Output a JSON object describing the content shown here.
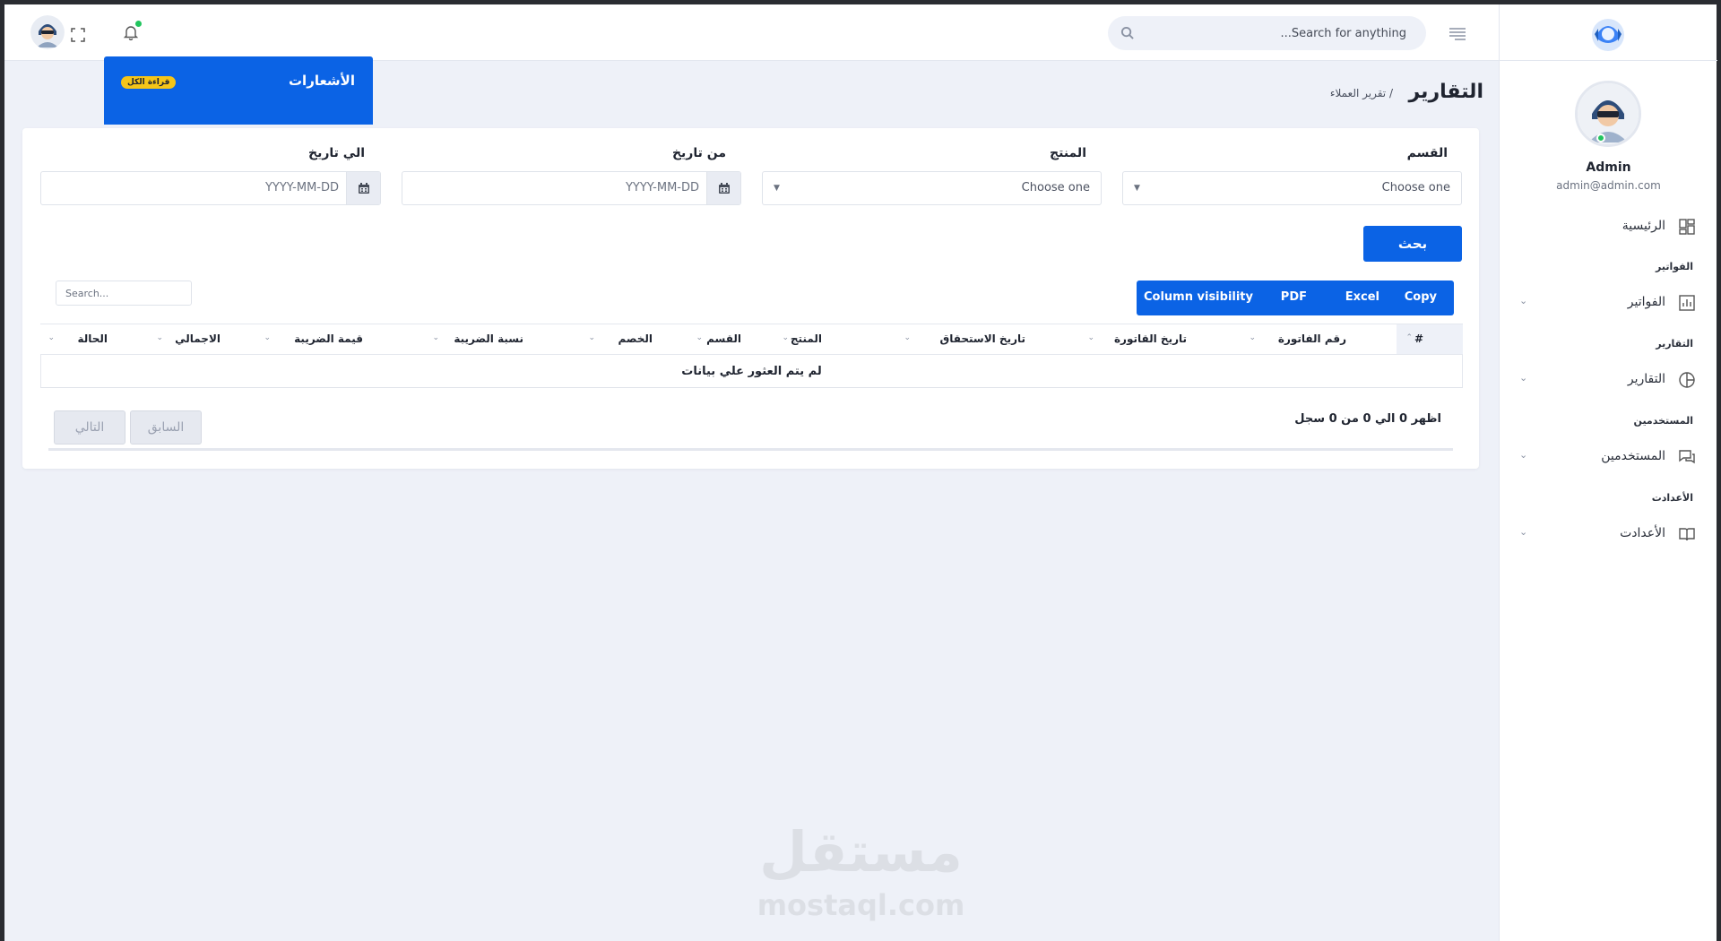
{
  "topbar": {
    "search_placeholder": "Search for anything...",
    "notifications": {
      "title": "الأشعارات",
      "read_all": "قراءة الكل"
    }
  },
  "sidebar": {
    "user": {
      "name": "Admin",
      "email": "admin@admin.com"
    },
    "items": [
      {
        "section": "",
        "label": "الرئيسية",
        "icon": "dashboard-icon",
        "expandable": false
      },
      {
        "section": "الفواتير",
        "label": "الفواتير",
        "icon": "bar-chart-icon",
        "expandable": true
      },
      {
        "section": "التقارير",
        "label": "التقارير",
        "icon": "pie-chart-icon",
        "expandable": true
      },
      {
        "section": "المستخدمين",
        "label": "المستخدمين",
        "icon": "chat-icon",
        "expandable": true
      },
      {
        "section": "الأعدادت",
        "label": "الأعدادت",
        "icon": "book-icon",
        "expandable": true
      }
    ]
  },
  "page": {
    "title": "التقارير",
    "breadcrumb": "/ تقرير العملاء"
  },
  "filters": {
    "department": {
      "label": "القسم",
      "value": "Choose one"
    },
    "product": {
      "label": "المنتج",
      "value": "Choose one"
    },
    "from_date": {
      "label": "من تاريخ",
      "placeholder": "YYYY-MM-DD"
    },
    "to_date": {
      "label": "الي تاريخ",
      "placeholder": "YYYY-MM-DD"
    },
    "search_button": "بحث"
  },
  "table": {
    "export_buttons": [
      "Copy",
      "Excel",
      "PDF",
      "Column visibility"
    ],
    "search_placeholder": "Search...",
    "columns": [
      "#",
      "رقم الفاتورة",
      "تاريخ القاتورة",
      "تاريخ الاستحقاق",
      "المنتج",
      "القسم",
      "الخصم",
      "نسبة الضريبة",
      "قيمة الضريبة",
      "الاجمالي",
      "الحالة"
    ],
    "empty_message": "لم يتم العثور علي بيانات",
    "info": "اظهر 0 الي 0 من 0 سجل",
    "prev_label": "السابق",
    "next_label": "التالي"
  },
  "watermark": {
    "arabic": "مستقل",
    "latin": "mostaql.com"
  },
  "colors": {
    "accent": "#0b63e5",
    "background": "#eef1f8",
    "online": "#22c55e",
    "badge": "#f5c518"
  }
}
